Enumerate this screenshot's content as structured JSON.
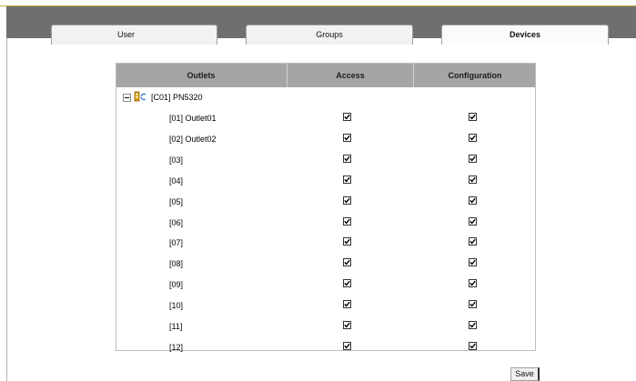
{
  "tabs": [
    {
      "label": "User"
    },
    {
      "label": "Groups"
    },
    {
      "label": "Devices"
    }
  ],
  "table": {
    "headers": {
      "outlets": "Outlets",
      "access": "Access",
      "configuration": "Configuration"
    },
    "device": {
      "label": "[C01] PN5320",
      "expanded": true,
      "icon": "power-device-icon"
    },
    "outlets": [
      {
        "name": "[01] Outlet01",
        "access": true,
        "configuration": true
      },
      {
        "name": "[02] Outlet02",
        "access": true,
        "configuration": true
      },
      {
        "name": "[03]",
        "access": true,
        "configuration": true
      },
      {
        "name": "[04]",
        "access": true,
        "configuration": true
      },
      {
        "name": "[05]",
        "access": true,
        "configuration": true
      },
      {
        "name": "[06]",
        "access": true,
        "configuration": true
      },
      {
        "name": "[07]",
        "access": true,
        "configuration": true
      },
      {
        "name": "[08]",
        "access": true,
        "configuration": true
      },
      {
        "name": "[09]",
        "access": true,
        "configuration": true
      },
      {
        "name": "[10]",
        "access": true,
        "configuration": true
      },
      {
        "name": "[11]",
        "access": true,
        "configuration": true
      },
      {
        "name": "[12]",
        "access": true,
        "configuration": true
      }
    ]
  },
  "save_label": "Save",
  "colors": {
    "tabbar": "#6f6f6f",
    "header": "#a5a5a5",
    "accent_line": "#c8a640"
  }
}
